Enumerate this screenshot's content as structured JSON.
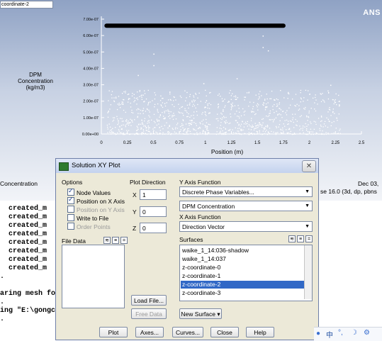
{
  "graphics": {
    "window_label": "coordinate-2",
    "logo": "ANS",
    "footer_left": "Concentration",
    "footer_right_line1": "Dec 03,",
    "footer_right_line2": "se 16.0 (3d, dp, pbns"
  },
  "chart_data": {
    "type": "scatter",
    "ylabel": [
      "DPM",
      "Concentration",
      "(kg/m3)"
    ],
    "xlabel": "Position (m)",
    "xlim": [
      0,
      2.5
    ],
    "ylim": [
      0,
      7e-07
    ],
    "xticks": [
      "0",
      "0.25",
      "0.5",
      "0.75",
      "1",
      "1.25",
      "1.5",
      "1.75",
      "2",
      "2.25",
      "2.5"
    ],
    "yticks": [
      "0.00e+00",
      "1.00e-07",
      "2.00e-07",
      "3.00e-07",
      "4.00e-07",
      "5.00e-07",
      "6.00e-07",
      "7.00e-07"
    ],
    "series": [
      {
        "band": {
          "x_start": 0.05,
          "x_end": 1.75,
          "y": 6.6e-07
        },
        "cluster_ranges_x": [
          [
            0.05,
            0.55
          ],
          [
            0.55,
            1.05
          ],
          [
            1.1,
            1.6
          ],
          [
            1.6,
            2.3
          ]
        ],
        "bulk_y_range": [
          0,
          2.7e-07
        ],
        "outliers": [
          [
            0.5,
            4.9e-07
          ],
          [
            0.5,
            4.2e-07
          ],
          [
            1.55,
            6e-07
          ],
          [
            1.55,
            5.3e-07
          ],
          [
            1.6,
            5.1e-07
          ],
          [
            0.35,
            3.6e-07
          ],
          [
            1.3,
            3.4e-07
          ],
          [
            0.98,
            3.1e-07
          ],
          [
            2.2,
            3e-07
          ]
        ]
      }
    ],
    "marker_color": "#ffffff"
  },
  "console": {
    "lines": [
      "  created_m",
      "  created_m",
      "  created_m",
      "  created_m",
      "  created_m",
      "  created_m",
      "  created_m",
      "  created_m",
      ".",
      "",
      "aring mesh fo",
      ".",
      "ing \"E:\\gongc",
      "."
    ]
  },
  "dialog": {
    "title": "Solution XY Plot",
    "options_label": "Options",
    "options": [
      {
        "label": "Node Values",
        "checked": true,
        "disabled": false
      },
      {
        "label": "Position on X Axis",
        "checked": true,
        "disabled": false
      },
      {
        "label": "Position on Y Axis",
        "checked": false,
        "disabled": true
      },
      {
        "label": "Write to File",
        "checked": false,
        "disabled": false
      },
      {
        "label": "Order Points",
        "checked": false,
        "disabled": true
      }
    ],
    "plot_direction_label": "Plot Direction",
    "x_label": "X",
    "x_value": "1",
    "y_label": "Y",
    "y_value": "0",
    "z_label": "Z",
    "z_value": "0",
    "y_axis_function_label": "Y Axis Function",
    "y_axis_category": "Discrete Phase Variables...",
    "y_axis_variable": "DPM Concentration",
    "x_axis_function_label": "X Axis Function",
    "x_axis_value": "Direction Vector",
    "file_data_label": "File Data",
    "surfaces_label": "Surfaces",
    "surfaces": [
      "waike_1_14:036-shadow",
      "waike_1_14:037",
      "z-coordinate-0",
      "z-coordinate-1",
      "z-coordinate-2",
      "z-coordinate-3"
    ],
    "selected_surface": "z-coordinate-2",
    "load_file_label": "Load File...",
    "free_data_label": "Free Data",
    "new_surface_label": "New Surface ▾",
    "buttons": {
      "plot": "Plot",
      "axes": "Axes...",
      "curves": "Curves...",
      "close": "Close",
      "help": "Help"
    }
  },
  "tray": {
    "ime_char": "中",
    "icons": [
      "paw-icon",
      "ime-icon",
      "dot-icon",
      "moon-icon",
      "settings-icon"
    ]
  }
}
